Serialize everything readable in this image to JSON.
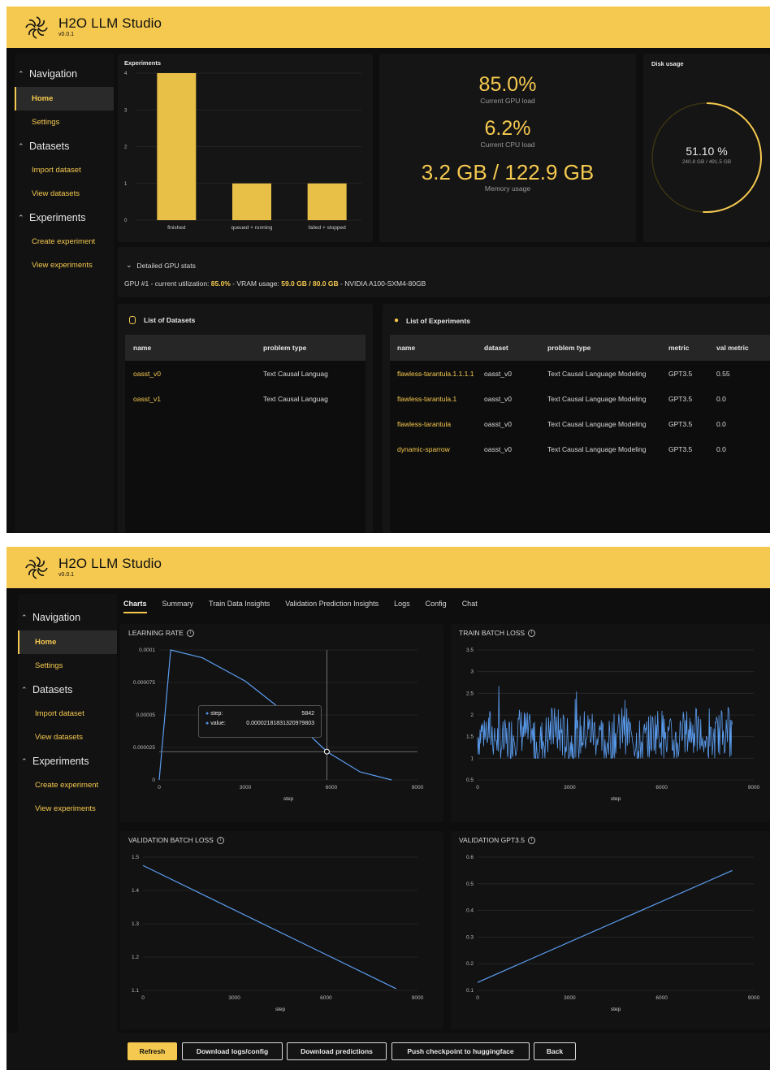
{
  "app": {
    "title": "H2O LLM Studio",
    "version": "v0.0.1"
  },
  "nav": {
    "sections": [
      {
        "label": "Navigation",
        "items": [
          "Home",
          "Settings"
        ]
      },
      {
        "label": "Datasets",
        "items": [
          "Import dataset",
          "View datasets"
        ]
      },
      {
        "label": "Experiments",
        "items": [
          "Create experiment",
          "View experiments"
        ]
      }
    ],
    "active": "Home"
  },
  "home": {
    "experiments_title": "Experiments",
    "chart_data": {
      "type": "bar",
      "title": "Experiments",
      "categories": [
        "finished",
        "queued + running",
        "failed + stopped"
      ],
      "values": [
        4,
        1,
        1
      ],
      "ylim": [
        0,
        4
      ],
      "yticks": [
        0,
        1,
        2,
        3,
        4
      ],
      "color": "#e8bf47"
    },
    "gpu_load": "85.0%",
    "gpu_load_label": "Current GPU load",
    "cpu_load": "6.2%",
    "cpu_load_label": "Current CPU load",
    "memory": "3.2 GB / 122.9 GB",
    "memory_label": "Memory usage",
    "disk_title": "Disk usage",
    "disk_pct": "51.10 %",
    "disk_detail": "240.8 GB / 491.5 GB",
    "disk_fraction": 0.511,
    "gpu_stats_toggle": "Detailed GPU stats",
    "gpu_stats_prefix": "GPU #1 - current utilization: ",
    "gpu_util": "85.0%",
    "gpu_vram_prefix": " - VRAM usage: ",
    "gpu_vram": "59.0 GB / 80.0 GB",
    "gpu_name": " - NVIDIA A100-SXM4-80GB",
    "datasets_title": "List of Datasets",
    "datasets_cols": [
      "name",
      "problem type"
    ],
    "datasets_rows": [
      [
        "oasst_v0",
        "Text Causal Languag"
      ],
      [
        "oasst_v1",
        "Text Causal Languag"
      ]
    ],
    "experiments_list_title": "List of Experiments",
    "exp_cols": [
      "name",
      "dataset",
      "problem type",
      "metric",
      "val metric"
    ],
    "exp_rows": [
      [
        "flawless-tarantula.1.1.1.1",
        "oasst_v0",
        "Text Causal Language Modeling",
        "GPT3.5",
        "0.55"
      ],
      [
        "flawless-tarantula.1",
        "oasst_v0",
        "Text Causal Language Modeling",
        "GPT3.5",
        "0.0"
      ],
      [
        "flawless-tarantula",
        "oasst_v0",
        "Text Causal Language Modeling",
        "GPT3.5",
        "0.0"
      ],
      [
        "dynamic-sparrow",
        "oasst_v0",
        "Text Causal Language Modeling",
        "GPT3.5",
        "0.0"
      ]
    ]
  },
  "experiment": {
    "tabs": [
      "Charts",
      "Summary",
      "Train Data Insights",
      "Validation Prediction Insights",
      "Logs",
      "Config",
      "Chat"
    ],
    "active_tab": "Charts",
    "tooltip": {
      "step_label": "step:",
      "step_value": "5842",
      "value_label": "value:",
      "value_value": "0.00002181831320979803"
    },
    "buttons": [
      "Refresh",
      "Download logs/config",
      "Download predictions",
      "Push checkpoint to huggingface",
      "Back"
    ],
    "charts": [
      {
        "title": "LEARNING RATE",
        "xlabel": "step",
        "x_ticks": [
          "0",
          "3000",
          "6000",
          "9000"
        ],
        "y_ticks": [
          "0",
          "0.000025",
          "0.00005",
          "0.000075",
          "0.0001"
        ],
        "type": "line"
      },
      {
        "title": "TRAIN BATCH LOSS",
        "xlabel": "step",
        "x_ticks": [
          "0",
          "3000",
          "6000",
          "9000"
        ],
        "y_ticks": [
          "0.5",
          "1",
          "1.5",
          "2",
          "2.5",
          "3",
          "3.5"
        ],
        "type": "line"
      },
      {
        "title": "VALIDATION BATCH LOSS",
        "xlabel": "step",
        "x_ticks": [
          "0",
          "3000",
          "6000",
          "9000"
        ],
        "y_ticks": [
          "1.1",
          "1.2",
          "1.3",
          "1.4",
          "1.5"
        ],
        "type": "line"
      },
      {
        "title": "VALIDATION GPT3.5",
        "xlabel": "step",
        "x_ticks": [
          "0",
          "3000",
          "6000",
          "9000"
        ],
        "y_ticks": [
          "0.1",
          "0.2",
          "0.3",
          "0.4",
          "0.5",
          "0.6"
        ],
        "type": "line"
      }
    ]
  },
  "chart_data": [
    {
      "type": "bar",
      "title": "Experiments",
      "categories": [
        "finished",
        "queued + running",
        "failed + stopped"
      ],
      "values": [
        4,
        1,
        1
      ],
      "ylim": [
        0,
        4
      ]
    },
    {
      "type": "line",
      "title": "LEARNING RATE",
      "xlabel": "step",
      "xlim": [
        0,
        9000
      ],
      "ylim": [
        0,
        0.0001
      ],
      "series": [
        {
          "x": [
            0,
            400,
            1500,
            3000,
            4500,
            5842,
            7000,
            8100
          ],
          "y": [
            0,
            0.0001,
            9.4e-05,
            7.6e-05,
            5e-05,
            2.18e-05,
            6.2e-06,
            0
          ]
        }
      ]
    },
    {
      "type": "line",
      "title": "TRAIN BATCH LOSS",
      "xlabel": "step",
      "xlim": [
        0,
        9000
      ],
      "ylim": [
        0.5,
        3.5
      ],
      "series": [
        {
          "x_range": [
            0,
            8300
          ],
          "y_range": [
            1.0,
            3.1
          ]
        }
      ]
    },
    {
      "type": "line",
      "title": "VALIDATION BATCH LOSS",
      "xlabel": "step",
      "xlim": [
        0,
        9000
      ],
      "ylim": [
        1.1,
        1.5
      ],
      "series": [
        {
          "x": [
            0,
            8300
          ],
          "y": [
            1.475,
            1.105
          ]
        }
      ]
    },
    {
      "type": "line",
      "title": "VALIDATION GPT3.5",
      "xlabel": "step",
      "xlim": [
        0,
        9000
      ],
      "ylim": [
        0.1,
        0.6
      ],
      "series": [
        {
          "x": [
            0,
            8300
          ],
          "y": [
            0.13,
            0.55
          ]
        }
      ]
    }
  ]
}
